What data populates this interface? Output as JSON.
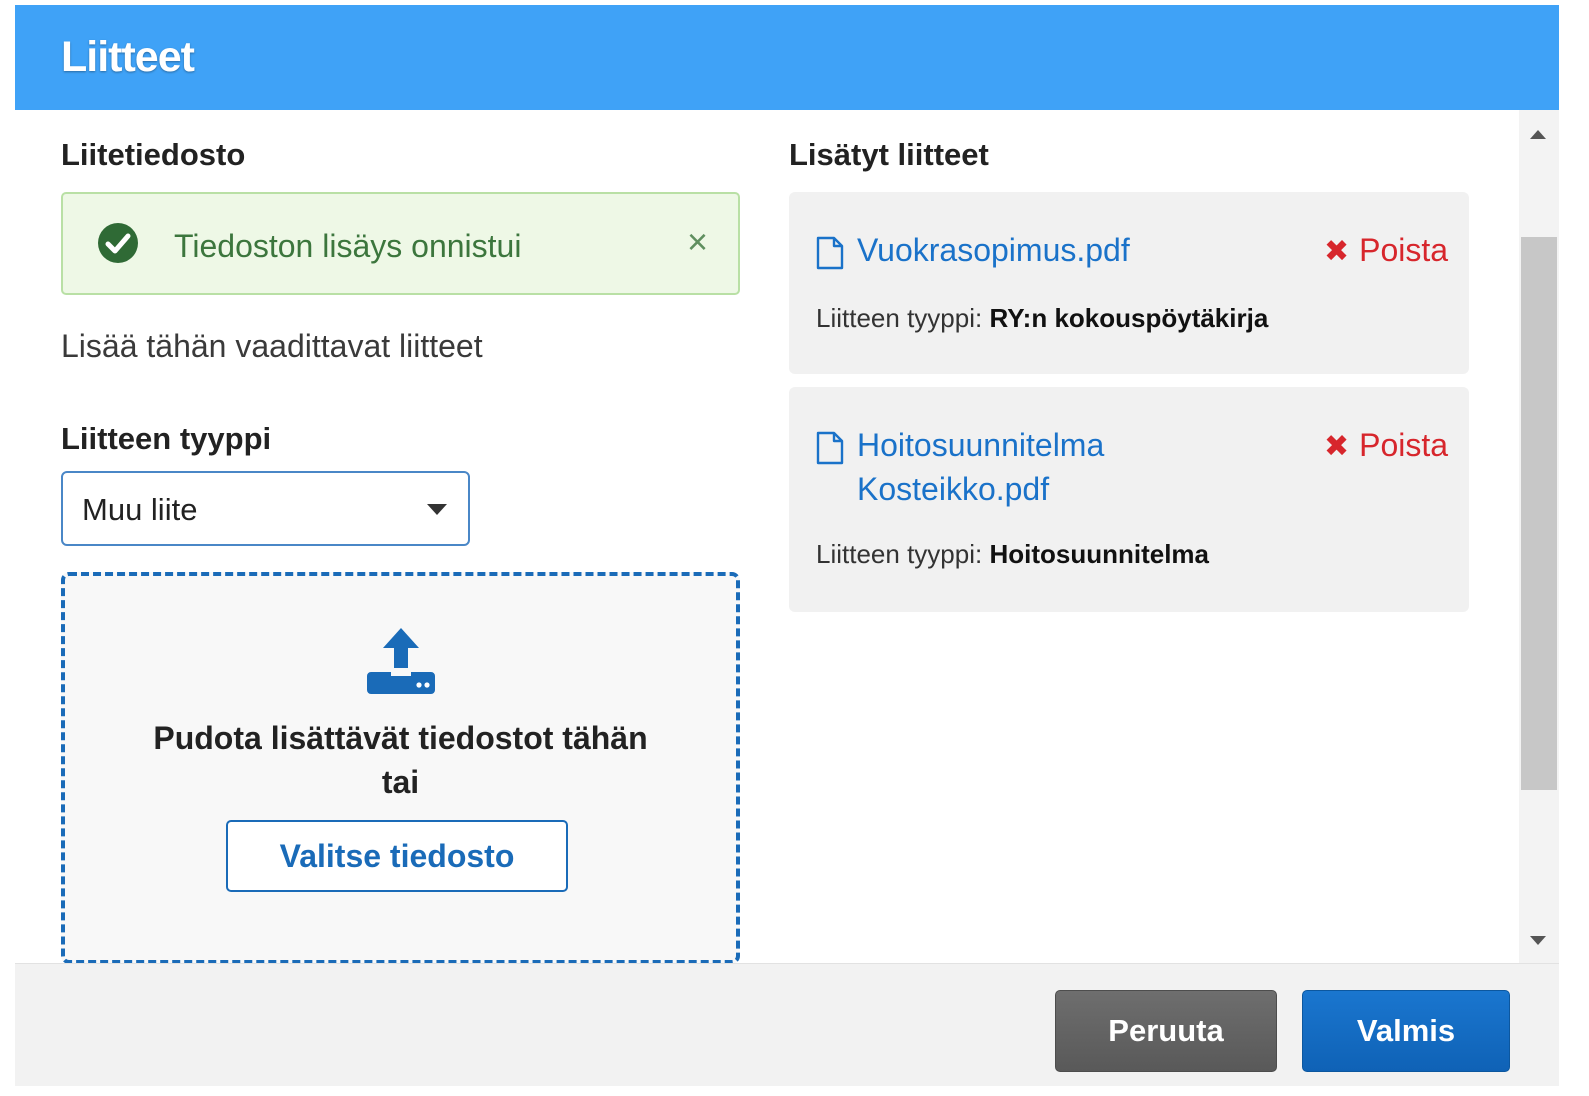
{
  "dialog": {
    "title": "Liitteet"
  },
  "left": {
    "section_title": "Liitetiedosto",
    "alert": {
      "message": "Tiedoston lisäys onnistui",
      "close_symbol": "×"
    },
    "helper_text": "Lisää tähän vaadittavat liitteet",
    "type_label": "Liitteen tyyppi",
    "type_select": {
      "selected": "Muu liite"
    },
    "dropzone": {
      "text_line1": "Pudota lisättävät tiedostot tähän",
      "text_line2": "tai",
      "button_label": "Valitse tiedosto"
    }
  },
  "right": {
    "section_title": "Lisätyt liitteet",
    "files": [
      {
        "name_line1": "Vuokrasopimus.pdf",
        "name_line2": "",
        "remove_label": "Poista",
        "type_prefix": "Liitteen tyyppi:",
        "type_value": "RY:n kokouspöytäkirja"
      },
      {
        "name_line1": "Hoitosuunnitelma",
        "name_line2": "Kosteikko.pdf",
        "remove_label": "Poista",
        "type_prefix": "Liitteen tyyppi:",
        "type_value": "Hoitosuunnitelma"
      }
    ]
  },
  "footer": {
    "cancel_label": "Peruuta",
    "done_label": "Valmis"
  },
  "icons": {
    "remove": "x-icon",
    "file": "file-icon",
    "upload": "upload-icon",
    "success": "check-circle-icon"
  },
  "colors": {
    "header": "#3fa2f7",
    "link": "#1a72c9",
    "danger": "#d7262c",
    "success_text": "#3c763d",
    "primary_button": "#1a76cf",
    "secondary_button": "#616161"
  }
}
